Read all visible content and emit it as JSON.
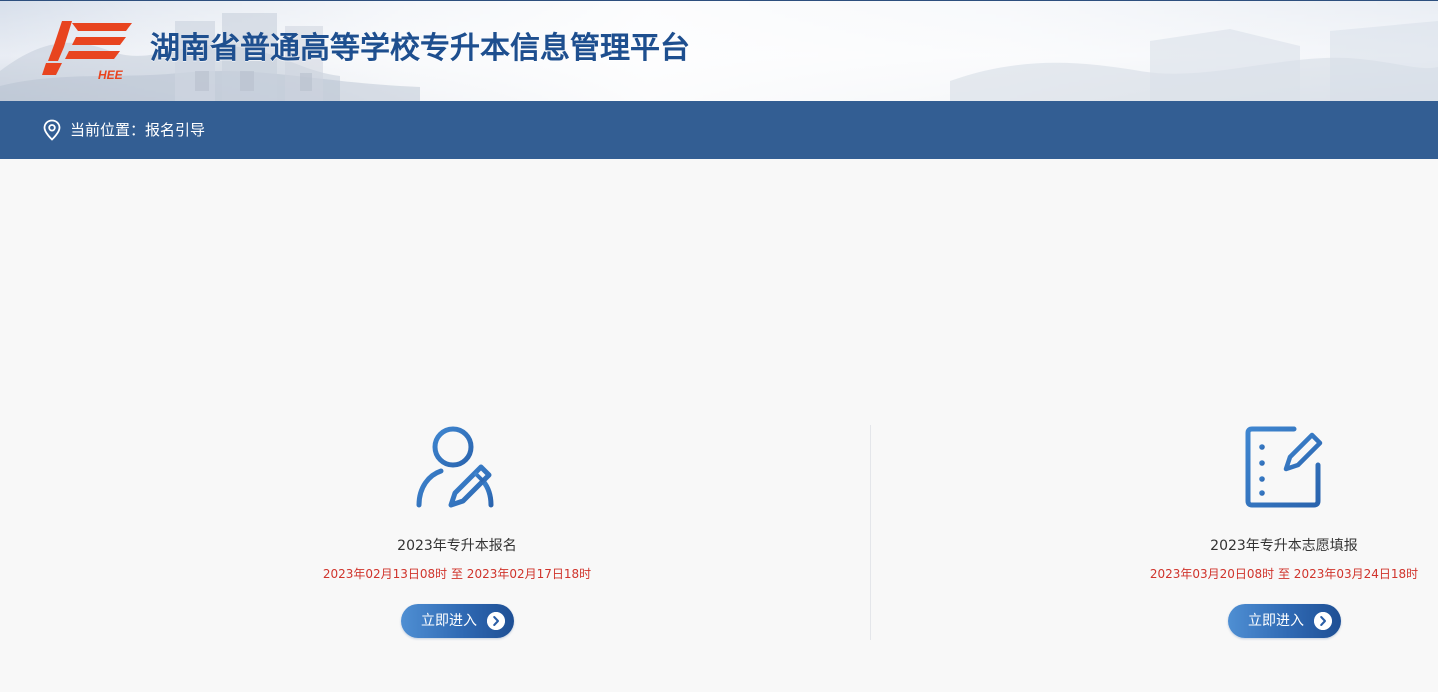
{
  "header": {
    "logo_icon": "hnee-logo-icon",
    "logo_text": "HEE",
    "title": "湖南省普通高等学校专升本信息管理平台",
    "title_color": "#1e4f8f",
    "logo_color": "#e8441f"
  },
  "location_bar": {
    "icon": "map-pin-icon",
    "label": "当前位置：",
    "current": "报名引导",
    "background": "#335e93"
  },
  "cards": [
    {
      "icon": "user-edit-icon",
      "title": "2023年专升本报名",
      "time_range": "2023年02月13日08时 至 2023年02月17日18时",
      "button_label": "立即进入",
      "button_icon": "chevron-right-icon"
    },
    {
      "icon": "document-edit-icon",
      "title": "2023年专升本志愿填报",
      "time_range": "2023年03月20日08时 至 2023年03月24日18时",
      "button_label": "立即进入",
      "button_icon": "chevron-right-icon"
    }
  ],
  "colors": {
    "accent": "#2f69b3",
    "time_red": "#d0342c",
    "page_bg": "#f8f8f8"
  }
}
